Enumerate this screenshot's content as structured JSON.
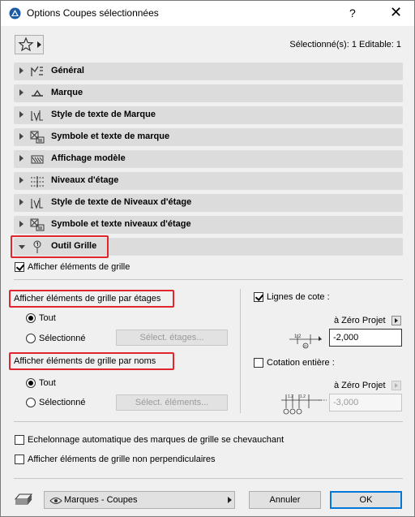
{
  "window": {
    "title": "Options Coupes sélectionnées",
    "help_label": "?",
    "close_label": "✕"
  },
  "header": {
    "selected_info": "Sélectionné(s): 1 Editable: 1"
  },
  "sections": [
    {
      "label": "Général",
      "icon": "general-settings-icon"
    },
    {
      "label": "Marque",
      "icon": "marker-icon"
    },
    {
      "label": "Style de texte de Marque",
      "icon": "text-style-icon"
    },
    {
      "label": "Symbole et texte de marque",
      "icon": "symbol-text-icon"
    },
    {
      "label": "Affichage modèle",
      "icon": "model-display-icon"
    },
    {
      "label": "Niveaux d'étage",
      "icon": "story-levels-icon"
    },
    {
      "label": "Style de texte de Niveaux d'étage",
      "icon": "text-style-icon"
    },
    {
      "label": "Symbole et texte niveaux d'étage",
      "icon": "symbol-text-icon"
    },
    {
      "label": "Outil Grille",
      "icon": "grid-tool-icon"
    }
  ],
  "grid": {
    "show_grid_elements": "Afficher éléments de grille",
    "by_stories": {
      "title": "Afficher éléments de grille par étages",
      "all": "Tout",
      "selected": "Sélectionné",
      "button": "Sélect. étages..."
    },
    "by_names": {
      "title": "Afficher éléments de grille par noms",
      "all": "Tout",
      "selected": "Sélectionné",
      "button": "Sélect. éléments..."
    },
    "dimension_lines": {
      "label": "Lignes de cote :",
      "zero_label": "à Zéro Projet",
      "value": "-2,000"
    },
    "overall_dimension": {
      "label": "Cotation entière :",
      "zero_label": "à Zéro Projet",
      "value": "-3,000"
    },
    "auto_stagger": "Echelonnage automatique des marques de grille se chevauchant",
    "non_perpendicular": "Afficher éléments de grille non perpendiculaires"
  },
  "footer": {
    "layer_dropdown": "Marques - Coupes",
    "cancel": "Annuler",
    "ok": "OK"
  }
}
